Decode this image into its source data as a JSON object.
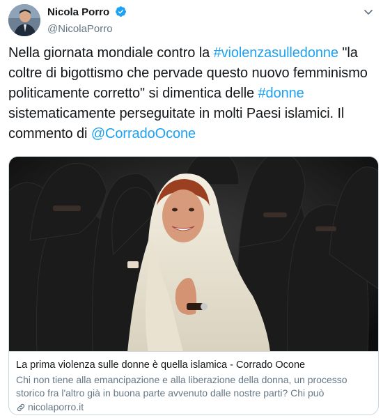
{
  "author": {
    "display_name": "Nicola Porro",
    "handle": "@NicolaPorro",
    "verified": true,
    "avatar_icon": "avatar-photo"
  },
  "tweet": {
    "segments": [
      {
        "text": "Nella giornata mondiale contro la ",
        "link": false
      },
      {
        "text": "#violenzasulledonne",
        "link": true
      },
      {
        "text": " \"la coltre di bigottismo che pervade questo nuovo femminismo politicamente corretto\" si dimentica delle ",
        "link": false
      },
      {
        "text": "#donne",
        "link": true
      },
      {
        "text": " sistematicamente perseguitate in molti Paesi islamici. Il commento di ",
        "link": false
      },
      {
        "text": "@CorradoOcone",
        "link": true
      }
    ]
  },
  "card": {
    "title": "La prima violenza sulle donne è quella islamica - Corrado Ocone",
    "description": "Chi non tiene alla emancipazione e alla liberazione della donna, un processo storico fra l'altro già in buona parte avvenuto dalle nostre parti? Chi può",
    "domain": "nicolaporro.it",
    "domain_icon": "link-icon"
  },
  "colors": {
    "link": "#1da1f2",
    "verified": "#1da1f2",
    "secondary_text": "#657786",
    "border": "#ccd6dd"
  }
}
